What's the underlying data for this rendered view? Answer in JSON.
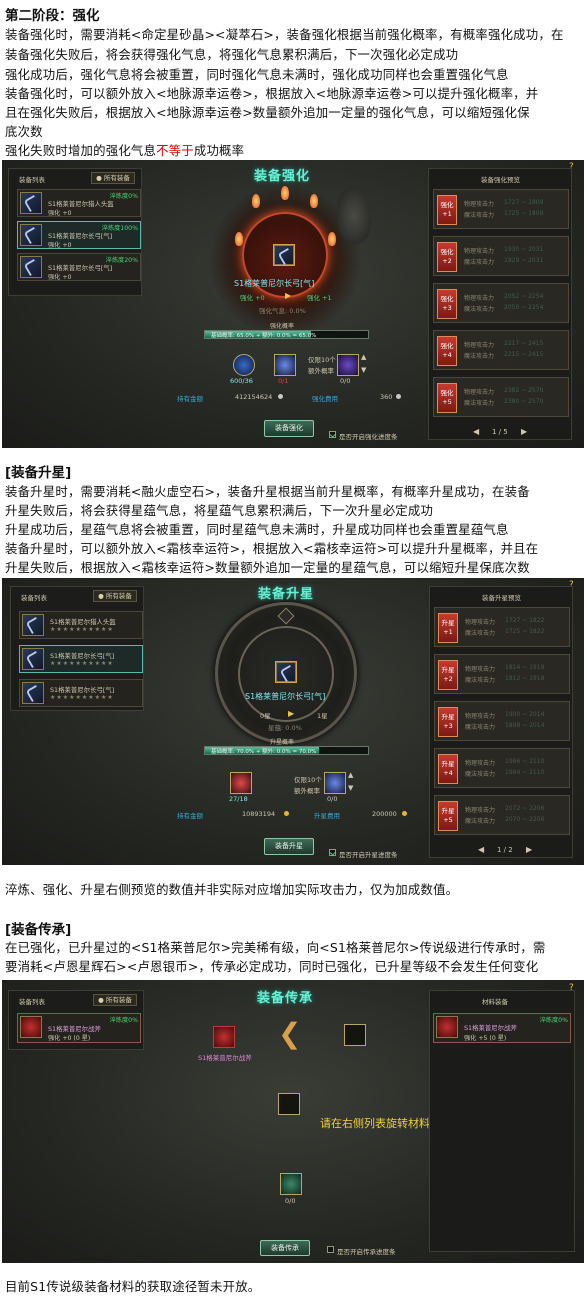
{
  "stage2": {
    "heading": "第二阶段：强化",
    "lines": [
      "装备强化时，需要消耗<命定星砂晶><凝萃石>，装备强化根据当前强化概率，有概率强化成功，在",
      "装备强化失败后，将会获得强化气息，将强化气息累积满后，下一次强化必定成功",
      "强化成功后，强化气息将会被重置，同时强化气息未满时，强化成功同样也会重置强化气息",
      "装备强化时，可以额外放入<地脉源幸运卷>，根据放入<地脉源幸运卷>可以提升强化概率，并",
      "且在强化失败后，根据放入<地脉源幸运卷>数量额外追加一定量的强化气息，可以缩短强化保",
      "底次数"
    ],
    "last_pre": "强化失败时增加的强化气息",
    "last_red": "不等于",
    "last_post": "成功概率"
  },
  "enhance_ui": {
    "title": "装备强化",
    "list_title": "装备列表",
    "all_btn": "● 所有装备",
    "preview_title": "装备强化预览",
    "help": "?",
    "items": [
      {
        "name": "S1格莱普尼尔猎人头盔",
        "tag": "淬炼度0%",
        "sub": "强化 +0"
      },
      {
        "name": "S1格莱普尼尔长弓[气]",
        "tag": "淬炼度100%",
        "sub": "强化 +0"
      },
      {
        "name": "S1格莱普尼尔长弓[气]",
        "tag": "淬炼度20%",
        "sub": "强化 +0"
      }
    ],
    "equip_name": "S1格莱普尼尔长弓[气]",
    "from": "强化 +0",
    "to": "强化 +1",
    "gauge": "强化气息: 0.0%",
    "rate_label": "强化概率",
    "rate_text": "基础概率: 65.0% + 额外: 0.0% = 65.0%",
    "rate": 0.65,
    "mat1": "600/36",
    "mat2": "0/1",
    "luck_label": "仅限10个",
    "extra_label": "额外概率",
    "mat3": "0/0",
    "hold_label": "持有金额",
    "hold_val": "412154624",
    "cost_label": "强化费用",
    "cost_val": "360",
    "btn": "装备强化",
    "auto": "是否开启强化进度条",
    "pager": "1 / 5",
    "levels": [
      {
        "b": "强化",
        "n": "+1",
        "l1": "物理攻击力",
        "v1": "1727 ~ 1809",
        "l2": "魔法攻击力",
        "v2": "1725 ~ 1809"
      },
      {
        "b": "强化",
        "n": "+2",
        "l1": "物理攻击力",
        "v1": "1930 ~ 2031",
        "l2": "魔法攻击力",
        "v2": "1929 ~ 2031"
      },
      {
        "b": "强化",
        "n": "+3",
        "l1": "物理攻击力",
        "v1": "2052 ~ 2254",
        "l2": "魔法攻击力",
        "v2": "2050 ~ 2254"
      },
      {
        "b": "强化",
        "n": "+4",
        "l1": "物理攻击力",
        "v1": "2217 ~ 2415",
        "l2": "魔法攻击力",
        "v2": "2215 ~ 2415"
      },
      {
        "b": "强化",
        "n": "+5",
        "l1": "物理攻击力",
        "v1": "2382 ~ 2570",
        "l2": "魔法攻击力",
        "v2": "2380 ~ 2570"
      }
    ]
  },
  "star": {
    "heading": "[装备升星]",
    "lines": [
      "装备升星时，需要消耗<融火虚空石>，装备升星根据当前升星概率，有概率升星成功，在装备",
      "升星失败后，将会获得星蕴气息，将星蕴气息累积满后，下一次升星必定成功",
      "升星成功后，星蕴气息将会被重置，同时星蕴气息未满时，升星成功同样也会重置星蕴气息",
      "装备升星时，可以额外放入<霜核幸运符>，根据放入<霜核幸运符>可以提升升星概率，并且在",
      "升星失败后，根据放入<霜核幸运符>数量额外追加一定量的星蕴气息，可以缩短升星保底次数"
    ]
  },
  "star_ui": {
    "title": "装备升星",
    "list_title": "装备列表",
    "all_btn": "● 所有装备",
    "preview_title": "装备升星预览",
    "help": "?",
    "items": [
      {
        "name": "S1格莱普尼尔猎人头盔",
        "stars": "★★★★★★★★★★"
      },
      {
        "name": "S1格莱普尼尔长弓[气]",
        "stars": "★★★★★★★★★★"
      },
      {
        "name": "S1格莱普尼尔长弓[气]",
        "stars": "★★★★★★★★★★"
      }
    ],
    "equip_name": "S1格莱普尼尔长弓[气]",
    "from": "0星",
    "to": "1星",
    "gauge": "星蕴: 0.0%",
    "rate_label": "升星概率",
    "rate_text": "基础概率: 70.0% + 额外: 0.0% = 70.0%",
    "rate": 0.7,
    "mat1": "27/18",
    "luck_label": "仅限10个",
    "extra_label": "额外概率",
    "mat3": "0/0",
    "hold_label": "持有金额",
    "hold_val": "10893194",
    "cost_label": "升星费用",
    "cost_val": "200000",
    "btn": "装备升星",
    "auto": "是否开启升星进度条",
    "pager": "1 / 2",
    "levels": [
      {
        "b": "升星",
        "n": "+1",
        "l1": "物理攻击力",
        "v1": "1727 ~ 1822",
        "l2": "魔法攻击力",
        "v2": "1725 ~ 1822"
      },
      {
        "b": "升星",
        "n": "+2",
        "l1": "物理攻击力",
        "v1": "1814 ~ 1918",
        "l2": "魔法攻击力",
        "v2": "1812 ~ 1918"
      },
      {
        "b": "升星",
        "n": "+3",
        "l1": "物理攻击力",
        "v1": "1900 ~ 2014",
        "l2": "魔法攻击力",
        "v2": "1898 ~ 2014"
      },
      {
        "b": "升星",
        "n": "+4",
        "l1": "物理攻击力",
        "v1": "1986 ~ 2110",
        "l2": "魔法攻击力",
        "v2": "1984 ~ 2110"
      },
      {
        "b": "升星",
        "n": "+5",
        "l1": "物理攻击力",
        "v1": "2072 ~ 2206",
        "l2": "魔法攻击力",
        "v2": "2070 ~ 2206"
      }
    ]
  },
  "note1": "淬炼、强化、升星右侧预览的数值并非实际对应增加实际攻击力，仅为加成数值。",
  "inherit": {
    "heading": "[装备传承]",
    "lines": [
      "在已强化，已升星过的<S1格莱普尼尔>完美稀有级，向<S1格莱普尼尔>传说级进行传承时，需",
      "要消耗<卢恩星辉石><卢恩银币>，传承必定成功，同时已强化，已升星等级不会发生任何变化"
    ]
  },
  "inherit_ui": {
    "title": "装备传承",
    "list_title": "装备列表",
    "all_btn": "● 所有装备",
    "mat_title": "材料装备",
    "help": "?",
    "item": {
      "name": "S1格莱普尼尔战斧",
      "tag": "淬炼度0%",
      "sub": "强化 +0   (0 星)"
    },
    "src_name": "S1格莱普尼尔战斧",
    "mat_item": {
      "name": "S1格莱普尼尔战斧",
      "tag": "淬炼度0%",
      "sub": "强化 +5   (0 星)"
    },
    "hint": "请在右侧列表旋转材料装备",
    "count": "0/0",
    "btn": "装备传承",
    "auto": "是否开启传承进度条"
  },
  "note2": "目前S1传说级装备材料的获取途径暂未开放。",
  "colors": {
    "accent": "#6bf0d3",
    "warning": "#e00000",
    "hint": "#f0d23a"
  }
}
